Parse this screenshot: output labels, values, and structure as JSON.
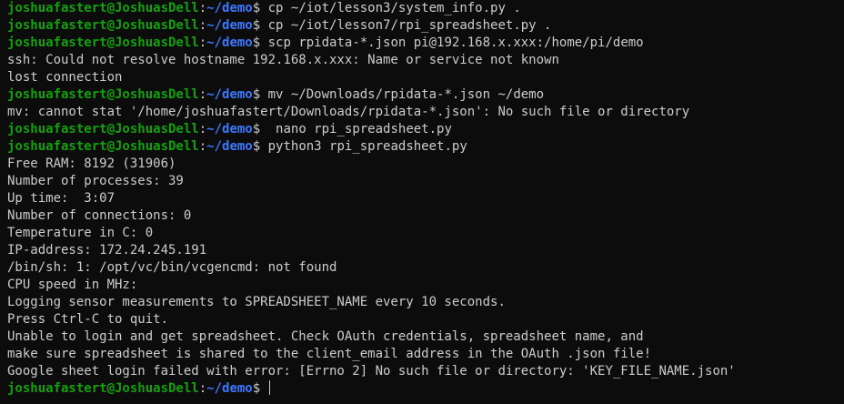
{
  "prompt": {
    "user_host": "joshuafastert@JoshuasDell",
    "separator": ":",
    "path": "~/demo",
    "symbol": "$"
  },
  "lines": [
    {
      "type": "prompt",
      "text": " cp ~/iot/lesson3/system_info.py ."
    },
    {
      "type": "prompt",
      "text": " cp ~/iot/lesson7/rpi_spreadsheet.py ."
    },
    {
      "type": "prompt",
      "text": " scp rpidata-*.json pi@192.168.x.xxx:/home/pi/demo"
    },
    {
      "type": "output",
      "text": "ssh: Could not resolve hostname 192.168.x.xxx: Name or service not known"
    },
    {
      "type": "output",
      "text": "lost connection"
    },
    {
      "type": "prompt",
      "text": " mv ~/Downloads/rpidata-*.json ~/demo"
    },
    {
      "type": "output",
      "text": "mv: cannot stat '/home/joshuafastert/Downloads/rpidata-*.json': No such file or directory"
    },
    {
      "type": "prompt",
      "text": "  nano rpi_spreadsheet.py"
    },
    {
      "type": "prompt",
      "text": " python3 rpi_spreadsheet.py"
    },
    {
      "type": "output",
      "text": "Free RAM: 8192 (31906)"
    },
    {
      "type": "output",
      "text": "Number of processes: 39"
    },
    {
      "type": "output",
      "text": "Up time:  3:07"
    },
    {
      "type": "output",
      "text": "Number of connections: 0"
    },
    {
      "type": "output",
      "text": "Temperature in C: 0"
    },
    {
      "type": "output",
      "text": "IP-address: 172.24.245.191"
    },
    {
      "type": "output",
      "text": "/bin/sh: 1: /opt/vc/bin/vcgencmd: not found"
    },
    {
      "type": "output",
      "text": "CPU speed in MHz:"
    },
    {
      "type": "output",
      "text": "Logging sensor measurements to SPREADSHEET_NAME every 10 seconds."
    },
    {
      "type": "output",
      "text": "Press Ctrl-C to quit."
    },
    {
      "type": "output",
      "text": "Unable to login and get spreadsheet. Check OAuth credentials, spreadsheet name, and"
    },
    {
      "type": "output",
      "text": "make sure spreadsheet is shared to the client_email address in the OAuth .json file!"
    },
    {
      "type": "output",
      "text": "Google sheet login failed with error: [Errno 2] No such file or directory: 'KEY_FILE_NAME.json'"
    },
    {
      "type": "prompt",
      "text": " ",
      "cursor": true
    }
  ],
  "colors": {
    "background": "#0c0c0c",
    "foreground": "#cccccc",
    "user_host": "#13a10e",
    "path": "#3b78ff"
  }
}
